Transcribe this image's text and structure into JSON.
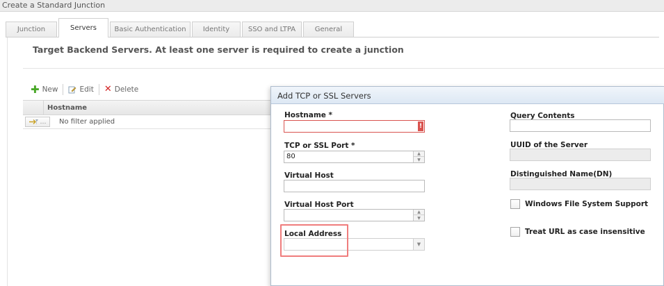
{
  "window": {
    "title": "Create a Standard Junction"
  },
  "tabs": [
    {
      "label": "Junction"
    },
    {
      "label": "Servers"
    },
    {
      "label": "Basic Authentication"
    },
    {
      "label": "Identity"
    },
    {
      "label": "SSO and LTPA"
    },
    {
      "label": "General"
    }
  ],
  "section": {
    "title": "Target Backend Servers. At least one server is required to create a junction"
  },
  "toolbar": {
    "new_label": "New",
    "edit_label": "Edit",
    "delete_label": "Delete"
  },
  "grid": {
    "columns": [
      "Hostname"
    ],
    "filter_button": "…",
    "filter_text": "No filter applied"
  },
  "dialog": {
    "title": "Add TCP or SSL Servers",
    "left": {
      "hostname_label": "Hostname *",
      "hostname_value": "",
      "hostname_error_icon": "!",
      "port_label": "TCP or SSL Port *",
      "port_value": "80",
      "virtual_host_label": "Virtual Host",
      "virtual_host_value": "",
      "virtual_host_port_label": "Virtual Host Port",
      "virtual_host_port_value": "",
      "local_address_label": "Local Address",
      "local_address_value": ""
    },
    "right": {
      "query_contents_label": "Query Contents",
      "query_contents_value": "",
      "uuid_label": "UUID of the Server",
      "uuid_value": "",
      "dn_label": "Distinguished Name(DN)",
      "dn_value": "",
      "windows_fs_label": "Windows File System Support",
      "case_insensitive_label": "Treat URL as case insensitive"
    }
  },
  "colors": {
    "highlight": "#ef7c7c",
    "error": "#d9534f",
    "new_icon": "#4aa829",
    "delete_icon": "#d22222"
  }
}
